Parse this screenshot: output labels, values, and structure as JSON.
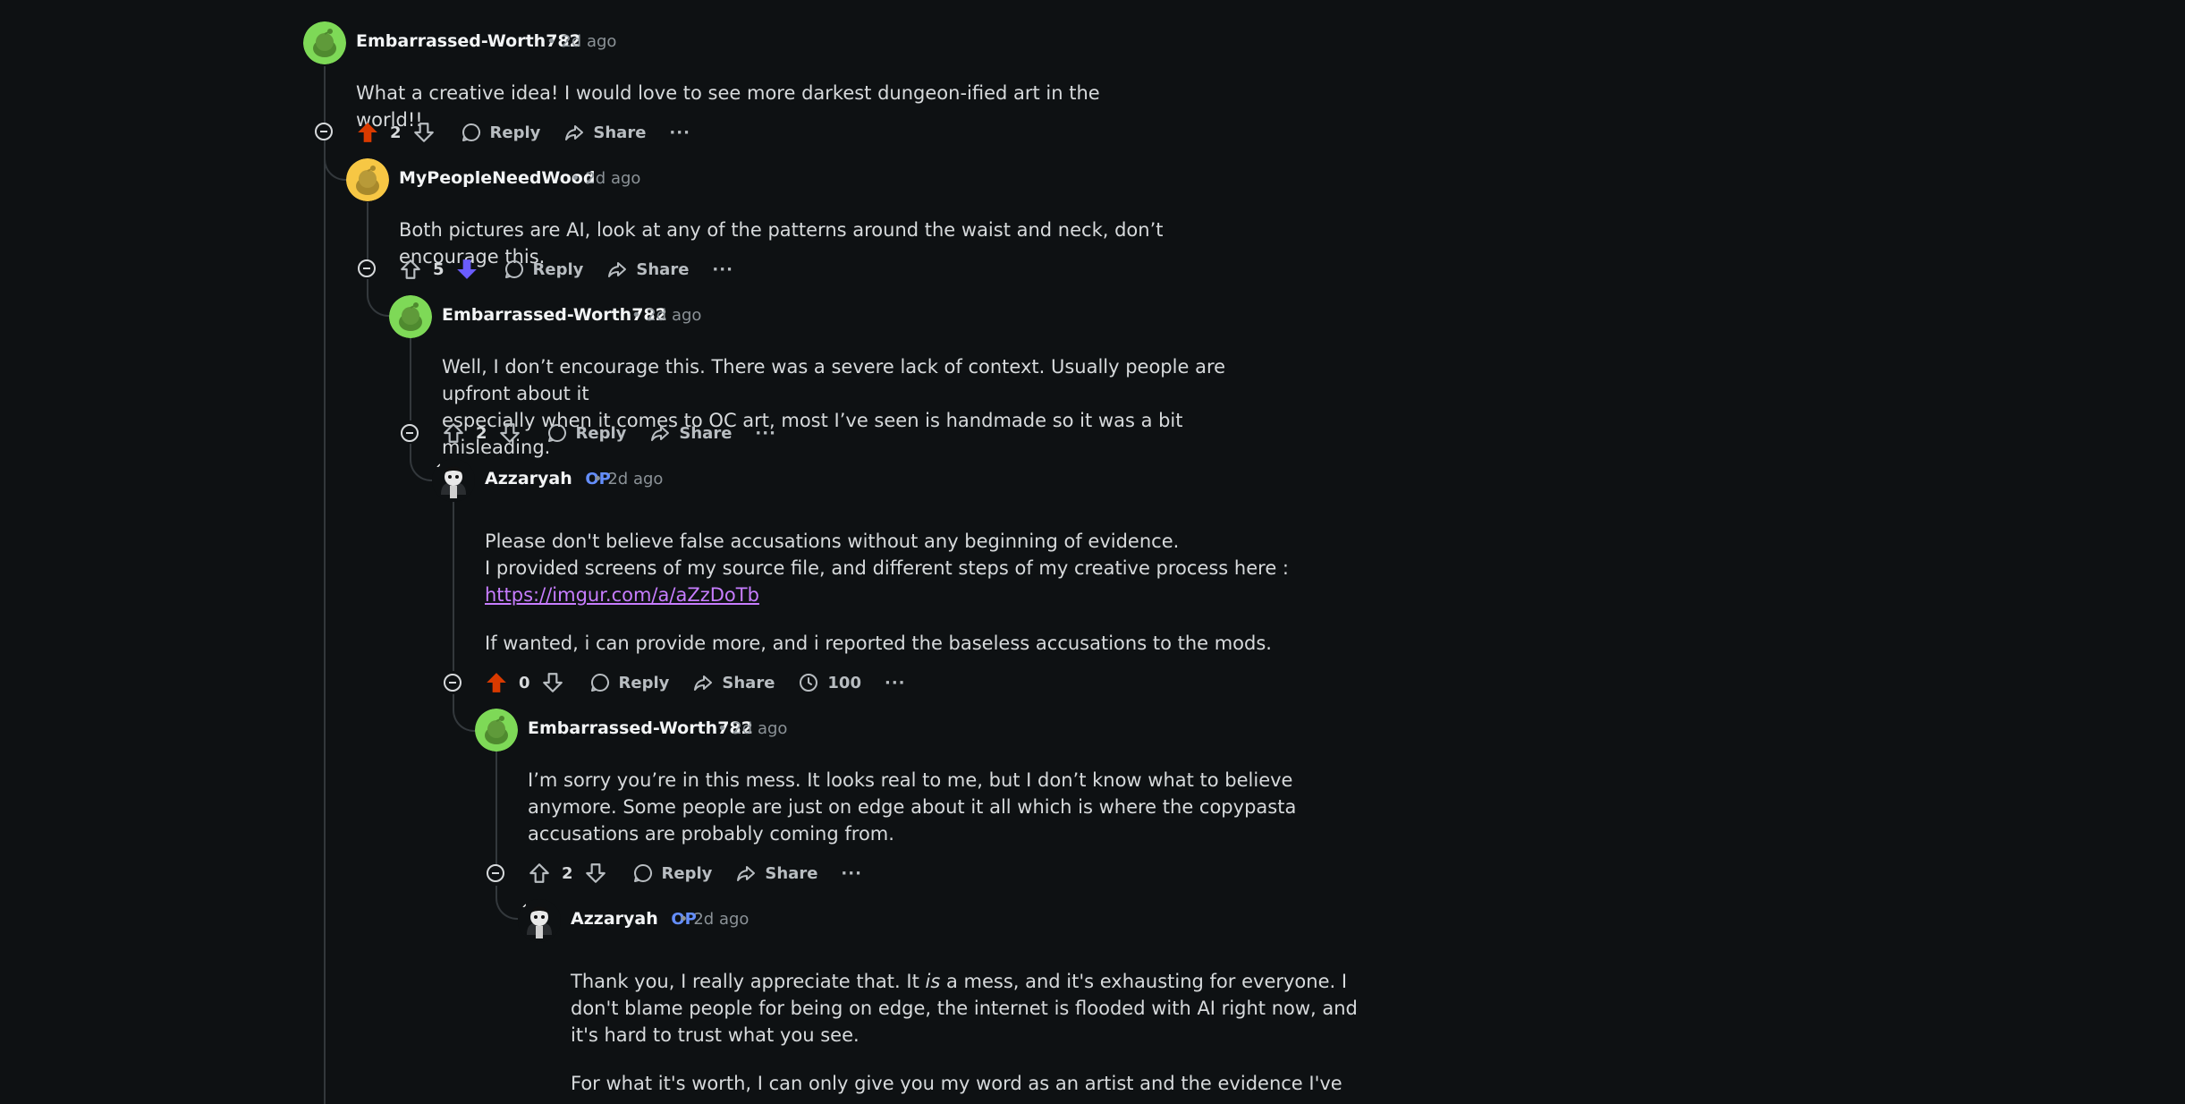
{
  "comments": [
    {
      "author": "Embarrassed-Worth782",
      "time": "• 2d ago",
      "body": [
        "What a creative idea! I would love to see more darkest dungeon-ified art in the world!!"
      ],
      "score": "2",
      "vote": "up",
      "reply": "Reply",
      "share": "Share",
      "more": "···"
    },
    {
      "author": "MyPeopleNeedWood",
      "time": "• 2d ago",
      "body": [
        "Both pictures are AI, look at any of the patterns around the waist and neck, don’t encourage this."
      ],
      "score": "5",
      "vote": "down",
      "reply": "Reply",
      "share": "Share",
      "more": "···"
    },
    {
      "author": "Embarrassed-Worth782",
      "time": "• 2d ago",
      "body": [
        "Well, I don’t encourage this. There was a severe lack of context. Usually people are upfront about it",
        "especially when it comes to OC art, most I’ve seen is handmade so it was a bit misleading."
      ],
      "score": "2",
      "vote": "none",
      "reply": "Reply",
      "share": "Share",
      "more": "···"
    },
    {
      "author": "Azzaryah",
      "op": "OP",
      "time": "• 2d ago",
      "body_p1_line1": "Please don't believe false accusations without any beginning of evidence.",
      "body_p1_line2": "I provided screens of my source file, and different steps of my creative process here :",
      "link": "https://imgur.com/a/aZzDoTb",
      "body_p2": "If wanted, i can provide more, and i reported the baseless accusations to the mods.",
      "score": "0",
      "vote": "up",
      "reply": "Reply",
      "share": "Share",
      "award": "100",
      "more": "···"
    },
    {
      "author": "Embarrassed-Worth782",
      "time": "• 2d ago",
      "body": [
        "I’m sorry you’re in this mess. It looks real to me, but I don’t know what to believe",
        "anymore. Some people are just on edge about it all which is where the copypasta",
        "accusations are probably coming from."
      ],
      "score": "2",
      "vote": "none",
      "reply": "Reply",
      "share": "Share",
      "more": "···"
    },
    {
      "author": "Azzaryah",
      "op": "OP",
      "time": "• 2d ago",
      "body_l1_pre": "Thank you, I really appreciate that. It ",
      "body_l1_em": "is",
      "body_l1_post": " a mess, and it's exhausting for everyone. I",
      "body_l2": "don't blame people for being on edge, the internet is flooded with AI right now, and",
      "body_l3": "it's hard to trust what you see.",
      "body_p2": "For what it's worth, I can only give you my word as an artist and the evidence I've"
    }
  ],
  "colors": {
    "background": "#0e1113",
    "upvote_active": "#d93a00",
    "downvote_active": "#6a5cff",
    "op": "#648efc",
    "link": "#c77dff"
  }
}
